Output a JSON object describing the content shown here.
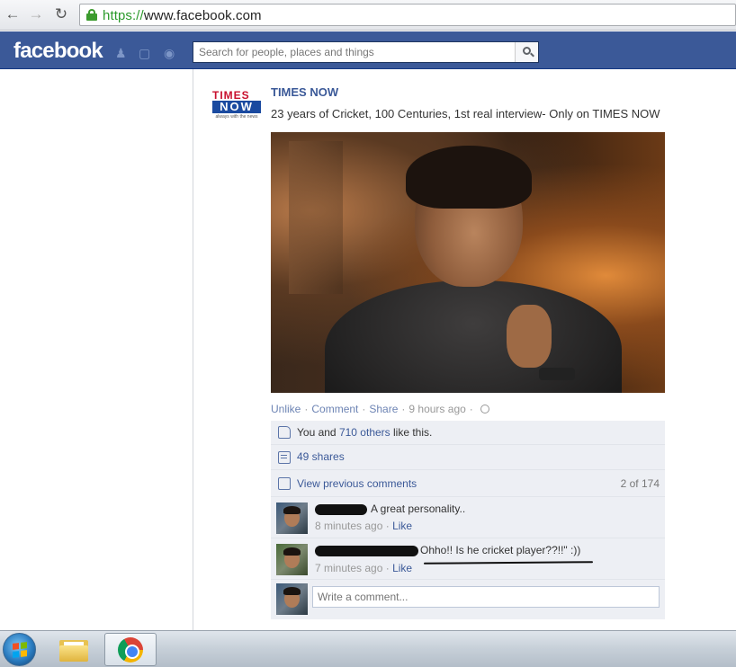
{
  "browser": {
    "url_scheme": "https://",
    "url_rest": "www.facebook.com"
  },
  "fb": {
    "logo": "facebook",
    "search_placeholder": "Search for people, places and things"
  },
  "post": {
    "page_name": "TIMES NOW",
    "logo_top": "TIMES",
    "logo_bottom": "NOW",
    "logo_tagline": "always with the news",
    "text": "23 years of Cricket, 100 Centuries, 1st real interview- Only on TIMES NOW",
    "actions": {
      "unlike": "Unlike",
      "comment": "Comment",
      "share": "Share",
      "sep": "·",
      "time": "9 hours ago"
    },
    "likes": {
      "prefix": "You and ",
      "others": "710 others",
      "suffix": " like this."
    },
    "shares": "49 shares",
    "view_previous": "View previous comments",
    "comment_count": "2 of 174",
    "comments": [
      {
        "text": "A great personality..",
        "time": "8 minutes ago",
        "like": "Like"
      },
      {
        "text": "Ohho!! Is he cricket player??!!\" :))",
        "time": "7 minutes ago",
        "like": "Like"
      }
    ],
    "write_placeholder": "Write a comment..."
  },
  "colors": {
    "fb_blue": "#3b5998",
    "link": "#6d84b4",
    "ufi_bg": "#edeff4"
  }
}
